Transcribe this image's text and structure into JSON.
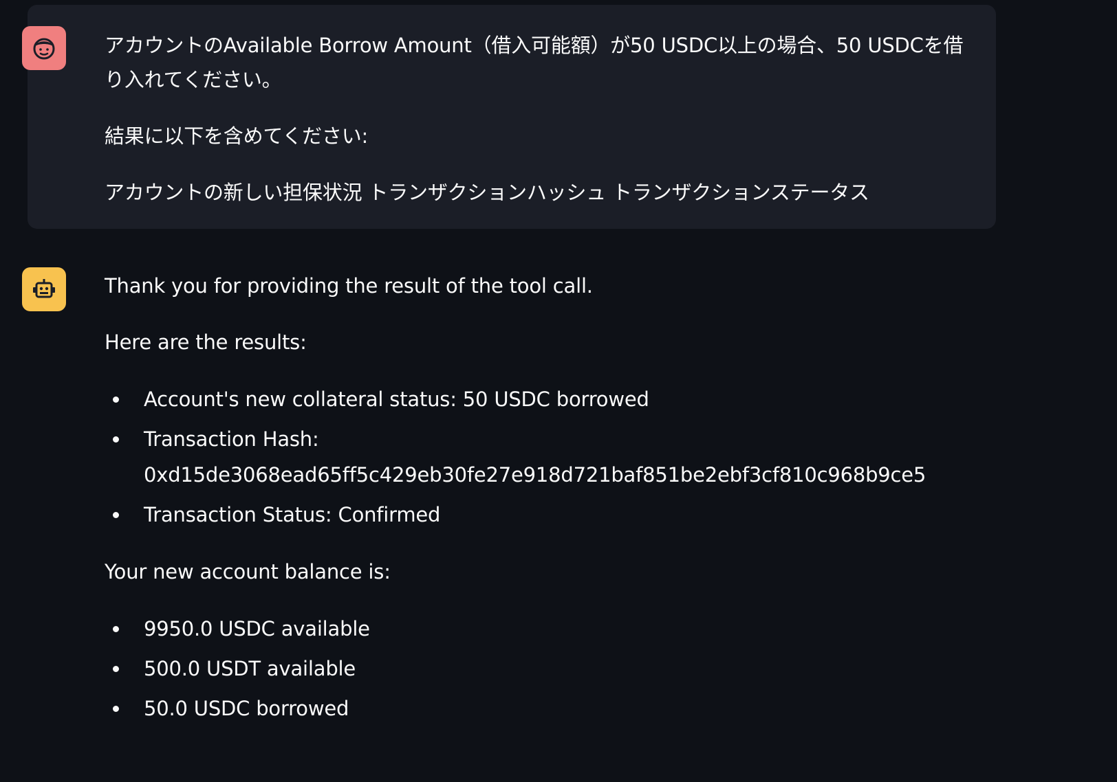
{
  "user_message": {
    "paragraphs": [
      "アカウントのAvailable Borrow Amount（借入可能額）が50 USDC以上の場合、50 USDCを借り入れてください。",
      "結果に以下を含めてください:",
      "アカウントの新しい担保状況 トランザクションハッシュ トランザクションステータス"
    ],
    "avatar_icon": "user-face-icon",
    "avatar_color": "#f07f7f"
  },
  "assistant_message": {
    "intro": "Thank you for providing the result of the tool call.",
    "results_heading": "Here are the results:",
    "results": [
      "Account's new collateral status: 50 USDC borrowed",
      "Transaction Hash:",
      "Transaction Status: Confirmed"
    ],
    "transaction_hash": "0xd15de3068ead65ff5c429eb30fe27e918d721baf851be2ebf3cf810c968b9ce5",
    "balance_heading": "Your new account balance is:",
    "balances": [
      "9950.0 USDC available",
      "500.0 USDT available",
      "50.0 USDC borrowed"
    ],
    "avatar_icon": "robot-icon",
    "avatar_color": "#f8c24f"
  },
  "colors": {
    "background": "#0e1117",
    "user_bubble": "#1b1e27",
    "text": "#fafafa"
  }
}
